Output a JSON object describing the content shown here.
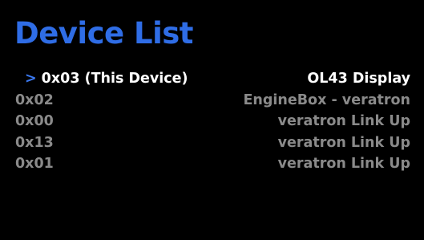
{
  "screen": {
    "title": "Device List"
  },
  "devices": [
    {
      "id": "0x03 (This Device)",
      "name": "OL43 Display",
      "selected": true
    },
    {
      "id": "0x02",
      "name": "EngineBox - veratron",
      "selected": false
    },
    {
      "id": "0x00",
      "name": "veratron Link Up",
      "selected": false
    },
    {
      "id": "0x13",
      "name": "veratron Link Up",
      "selected": false
    },
    {
      "id": "0x01",
      "name": "veratron Link Up",
      "selected": false
    }
  ],
  "cursor_glyph": ">",
  "colors": {
    "background": "#000000",
    "title": "#2f6de6",
    "cursor": "#3a78f0",
    "selected_text": "#ffffff",
    "unselected_text": "#8a8a8a"
  }
}
